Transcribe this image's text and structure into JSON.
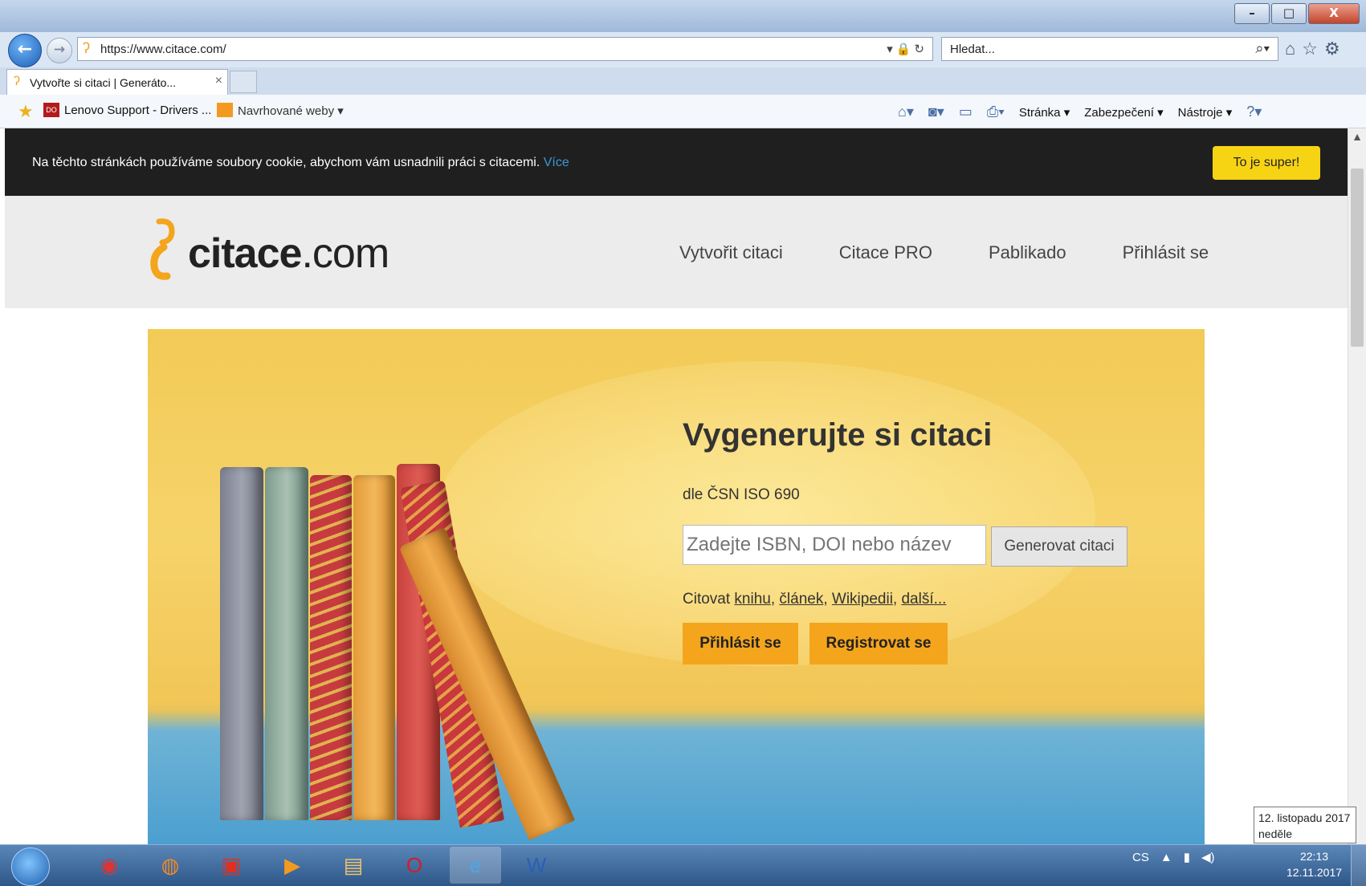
{
  "window": {
    "minimize": "–",
    "maximize": "□",
    "close": "X"
  },
  "navbar": {
    "url": "https://www.citace.com/",
    "search_placeholder": "Hledat..."
  },
  "tab": {
    "title": "Vytvořte si citaci | Generáto...",
    "close": "×"
  },
  "favorites": {
    "item1_icon_text": "DO",
    "item1": "Lenovo Support - Drivers ...",
    "item2": "Navrhované weby ▾"
  },
  "command_bar": {
    "page": "Stránka ▾",
    "security": "Zabezpečení ▾",
    "tools": "Nástroje ▾"
  },
  "cookie_bar": {
    "text": "Na těchto stránkách používáme soubory cookie, abychom vám usnadnili práci s citacemi.",
    "more_link": "Více",
    "accept_button": "To je super!"
  },
  "site": {
    "logo_bold": "citace",
    "logo_rest": ".com",
    "nav": [
      "Vytvořit citaci",
      "Citace PRO",
      "Pablikado",
      "Přihlásit se"
    ]
  },
  "hero": {
    "title": "Vygenerujte si citaci",
    "subtitle": "dle ČSN ISO 690",
    "input_placeholder": "Zadejte ISBN, DOI nebo název",
    "generate_button": "Generovat citaci",
    "cite_prefix": "Citovat",
    "cite_links": [
      "knihu",
      "článek",
      "Wikipedii",
      "další..."
    ],
    "login_button": "Přihlásit se",
    "register_button": "Registrovat se"
  },
  "taskbar": {
    "language": "CS",
    "time": "22:13",
    "date": "12.11.2017"
  },
  "tooltip": {
    "line1": "12. listopadu 2017",
    "line2": "neděle"
  },
  "colors": {
    "cookie_bg": "#1f1f1f",
    "accept_yellow": "#f7d413",
    "brand_orange": "#f4a51c",
    "link_blue": "#3d97d9",
    "header_gray": "#ececec"
  },
  "icons": [
    "back-icon",
    "forward-icon",
    "lock-icon",
    "refresh-icon",
    "search-icon",
    "home-icon",
    "favorites-star-icon",
    "gear-icon",
    "rss-icon",
    "print-icon",
    "help-icon",
    "windows-start-icon",
    "chrome-icon",
    "firefox-icon",
    "opera-icon",
    "ie-icon",
    "word-icon",
    "folder-icon",
    "media-icon",
    "volume-icon",
    "network-icon"
  ]
}
